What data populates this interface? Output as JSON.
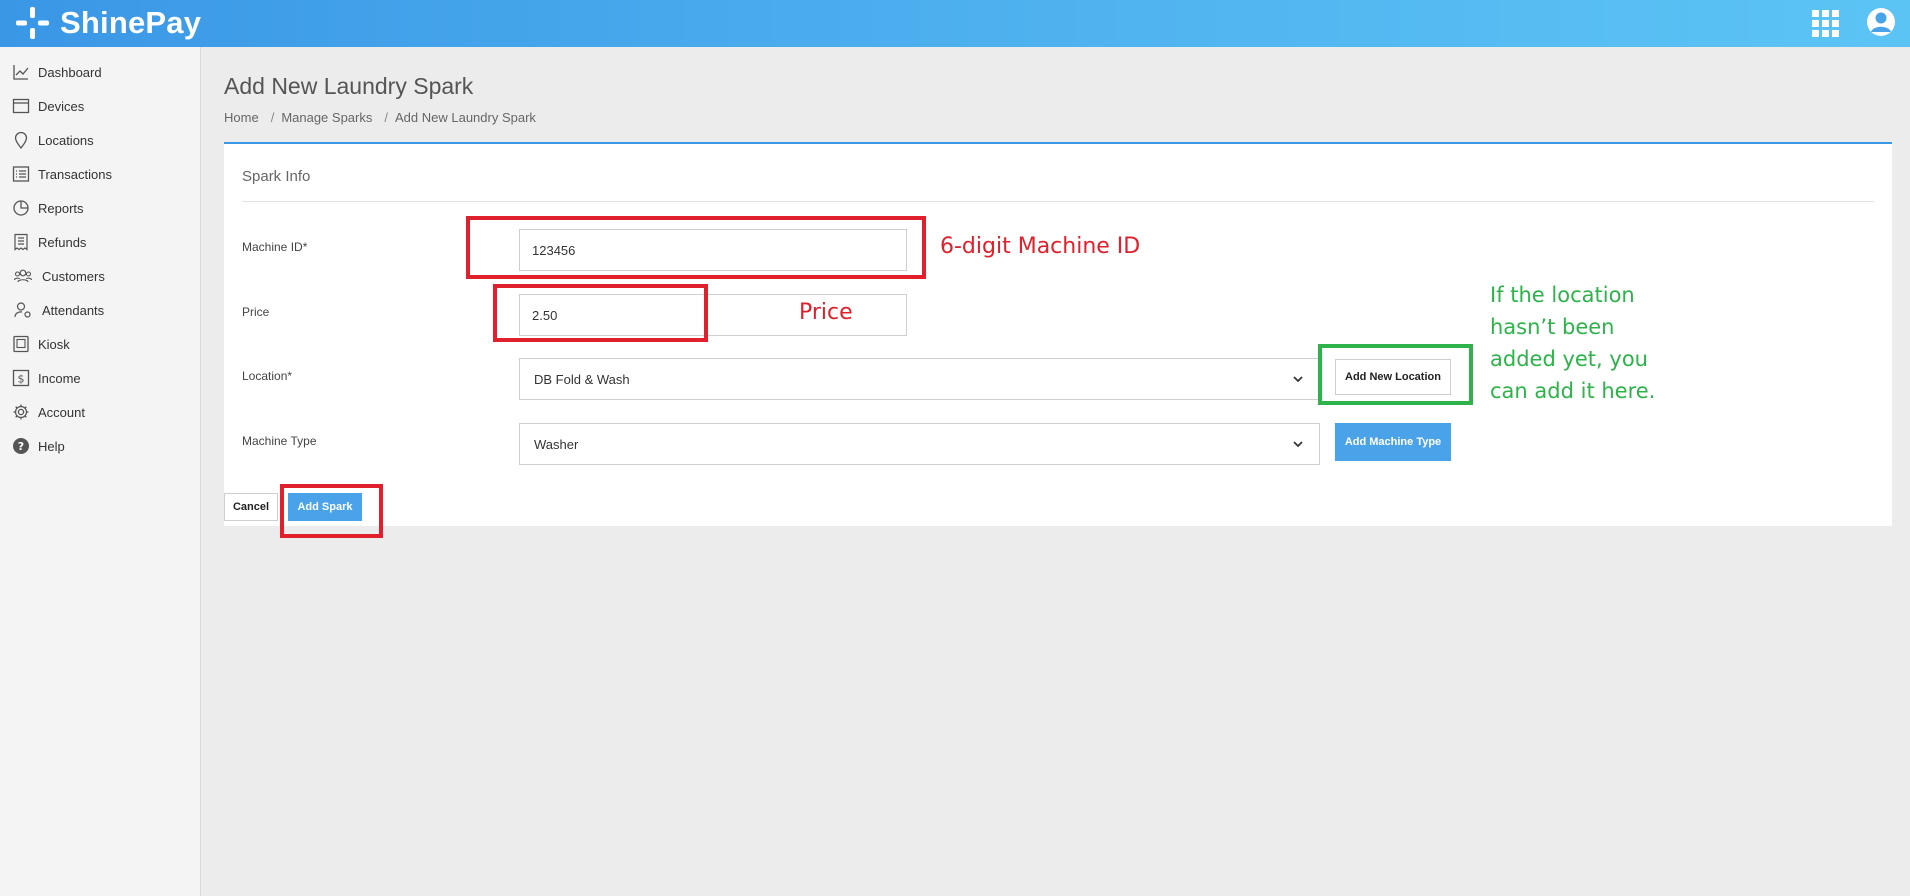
{
  "app": {
    "name": "ShinePay",
    "logo_icon": "plus-spark-icon",
    "header_icons": [
      "apps-grid-icon",
      "user-account-icon"
    ],
    "colors": {
      "header": "#3a97e6",
      "accent": "#4aa3e8",
      "annotation_red": "#e0202c",
      "annotation_green": "#2db34a"
    }
  },
  "sidebar": {
    "items": [
      {
        "label": "Dashboard",
        "icon": "chart-line-icon"
      },
      {
        "label": "Devices",
        "icon": "window-icon"
      },
      {
        "label": "Locations",
        "icon": "map-pin-icon"
      },
      {
        "label": "Transactions",
        "icon": "list-icon"
      },
      {
        "label": "Reports",
        "icon": "pie-chart-icon"
      },
      {
        "label": "Refunds",
        "icon": "receipt-icon"
      },
      {
        "label": "Customers",
        "icon": "users-icon"
      },
      {
        "label": "Attendants",
        "icon": "user-gear-icon"
      },
      {
        "label": "Kiosk",
        "icon": "kiosk-icon"
      },
      {
        "label": "Income",
        "icon": "dollar-icon"
      },
      {
        "label": "Account",
        "icon": "gear-icon"
      },
      {
        "label": "Help",
        "icon": "help-circle-icon"
      }
    ]
  },
  "page": {
    "title": "Add New Laundry Spark",
    "breadcrumb": [
      "Home",
      "Manage Sparks",
      "Add New Laundry Spark"
    ],
    "breadcrumb_sep": "/"
  },
  "form": {
    "section_title": "Spark Info",
    "machine_id": {
      "label": "Machine ID*",
      "value": "123456"
    },
    "price": {
      "label": "Price",
      "value": "2.50"
    },
    "location": {
      "label": "Location*",
      "value": "DB Fold & Wash",
      "add_button": "Add New Location"
    },
    "machine_type": {
      "label": "Machine Type",
      "value": "Washer",
      "add_button": "Add Machine Type"
    },
    "cancel_button": "Cancel",
    "submit_button": "Add Spark"
  },
  "annotations": {
    "machine_id_note": "6-digit Machine ID",
    "price_note": "Price",
    "location_note_lines": [
      "If the location",
      "hasn’t been",
      "added yet, you",
      "can add  it here."
    ]
  }
}
